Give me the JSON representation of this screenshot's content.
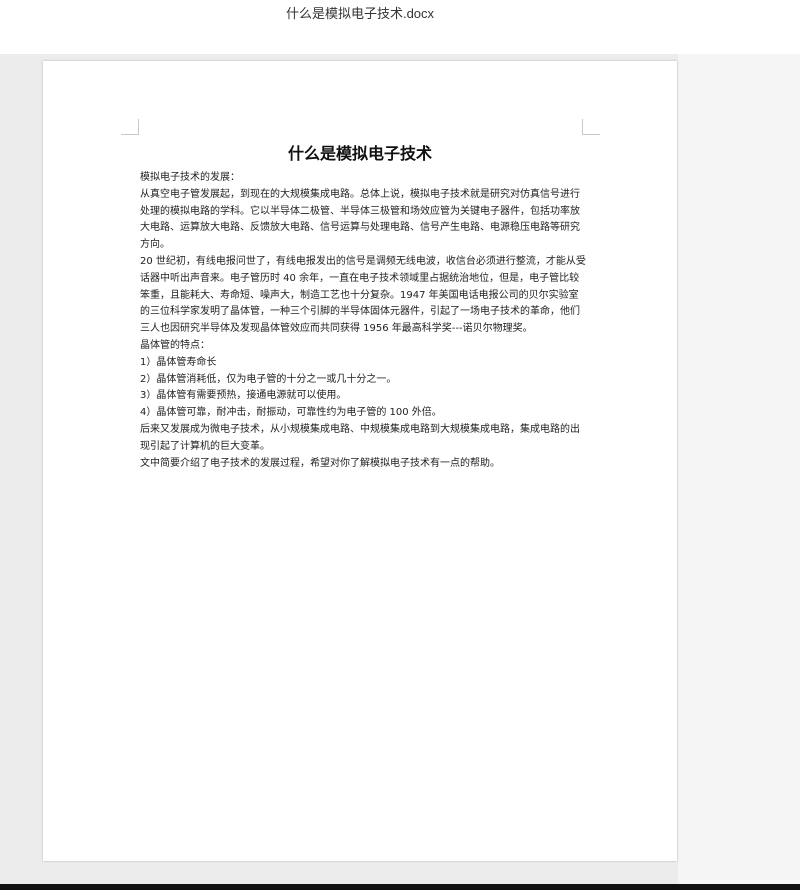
{
  "window": {
    "filename": "什么是模拟电子技术.docx"
  },
  "document": {
    "title": "什么是模拟电子技术",
    "paragraphs": [
      "模拟电子技术的发展：",
      "从真空电子管发展起，到现在的大规模集成电路。总体上说，模拟电子技术就是研究对仿真信号进行处理的模拟电路的学科。它以半导体二极管、半导体三极管和场效应管为关键电子器件，包括功率放大电路、运算放大电路、反馈放大电路、信号运算与处理电路、信号产生电路、电源稳压电路等研究方向。",
      "20 世纪初，有线电报问世了，有线电报发出的信号是调频无线电波，收信台必须进行整流，才能从受话器中听出声音来。电子管历时 40 余年，一直在电子技术领域里占据统治地位，但是，电子管比较笨重，且能耗大、寿命短、噪声大，制造工艺也十分复杂。1947 年美国电话电报公司的贝尔实验室的三位科学家发明了晶体管，一种三个引脚的半导体固体元器件，引起了一场电子技术的革命，他们三人也因研究半导体及发现晶体管效应而共同获得 1956 年最高科学奖---诺贝尔物理奖。",
      "晶体管的特点：",
      "1）晶体管寿命长",
      "2）晶体管消耗低，仅为电子管的十分之一或几十分之一。",
      "3）晶体管有需要预热，接通电源就可以使用。",
      "4）晶体管可靠，耐冲击，耐振动，可靠性约为电子管的 100 外倍。",
      "后来又发展成为微电子技术，从小规模集成电路、中规模集成电路到大规模集成电路，集成电路的出现引起了计算机的巨大变革。",
      "文中简要介绍了电子技术的发展过程，希望对你了解模拟电子技术有一点的帮助。"
    ]
  }
}
